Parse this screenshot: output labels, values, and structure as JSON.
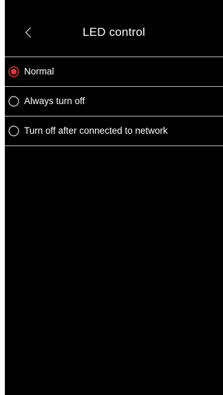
{
  "header": {
    "back_icon": "chevron-left-icon",
    "title": "LED control"
  },
  "colors": {
    "background": "#000000",
    "accent": "#e8323c",
    "text": "#ffffff",
    "radio_unselected": "#d9d9d9",
    "divider": "#bdbdbd"
  },
  "options": [
    {
      "label": "Normal",
      "selected": true
    },
    {
      "label": "Always turn off",
      "selected": false
    },
    {
      "label": "Turn off after connected to network",
      "selected": false
    }
  ]
}
